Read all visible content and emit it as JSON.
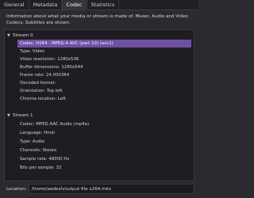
{
  "tabs": [
    "General",
    "Metadata",
    "Codec",
    "Statistics"
  ],
  "info_text": "Information about what your media or stream is made of. Muxer, Audio and Video Codecs, Subtitles are shown.",
  "streams": [
    {
      "header": "Stream 0",
      "expanded_icon": "triangle-down",
      "rows": [
        "Codec: H264 - MPEG-4 AVC (part 10) (avc1)",
        "Type: Video",
        "Video resolution: 1280x536",
        "Buffer dimensions: 1280x544",
        "Frame rate: 24.000384",
        "Decoded format:",
        "Orientation: Top left",
        "Chroma location: Left"
      ]
    },
    {
      "header": "Stream 1",
      "expanded_icon": "triangle-down",
      "rows": [
        "Codec: MPEG AAC Audio (mp4a)",
        "Language: Hindi",
        "Type: Audio",
        "Channels: Stereo",
        "Sample rate: 48000 Hz",
        "Bits per sample: 32"
      ]
    }
  ],
  "location": {
    "label": "Location:",
    "value": "/home/aadesh/output file x264.mkv"
  },
  "colors": {
    "selection": "#6f50a3",
    "background": "#2b2b2f",
    "panel": "#1e1e22"
  }
}
